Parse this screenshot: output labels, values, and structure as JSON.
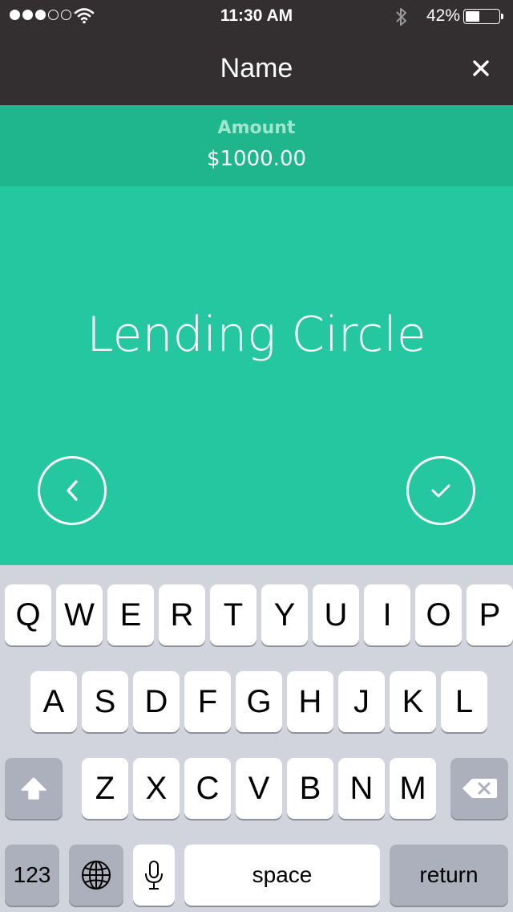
{
  "status_bar": {
    "time": "11:30 AM",
    "battery_percent": "42%",
    "battery_level": 0.42,
    "signal_bars_filled": 3,
    "signal_bars_total": 5,
    "icons": [
      "wifi-icon",
      "bluetooth-icon",
      "battery-icon"
    ]
  },
  "nav": {
    "title": "Name",
    "close_icon": "close-icon"
  },
  "amount": {
    "label": "Amount",
    "value": "$1000.00"
  },
  "form": {
    "name_value": "Lending Circle",
    "back_icon": "chevron-left-icon",
    "confirm_icon": "checkmark-icon"
  },
  "keyboard": {
    "row1": [
      "Q",
      "W",
      "E",
      "R",
      "T",
      "Y",
      "U",
      "I",
      "O",
      "P"
    ],
    "row2": [
      "A",
      "S",
      "D",
      "F",
      "G",
      "H",
      "J",
      "K",
      "L"
    ],
    "row3": [
      "Z",
      "X",
      "C",
      "V",
      "B",
      "N",
      "M"
    ],
    "numbers_label": "123",
    "space_label": "space",
    "return_label": "return",
    "icons": [
      "shift-icon",
      "delete-icon",
      "globe-icon",
      "microphone-icon"
    ]
  },
  "colors": {
    "header": "#332f31",
    "amount_bar": "#1fb68d",
    "main": "#24c79f",
    "amount_label": "#9ee6cd",
    "keyboard_bg": "#d1d4dc",
    "key_dark": "#abb0bc"
  }
}
